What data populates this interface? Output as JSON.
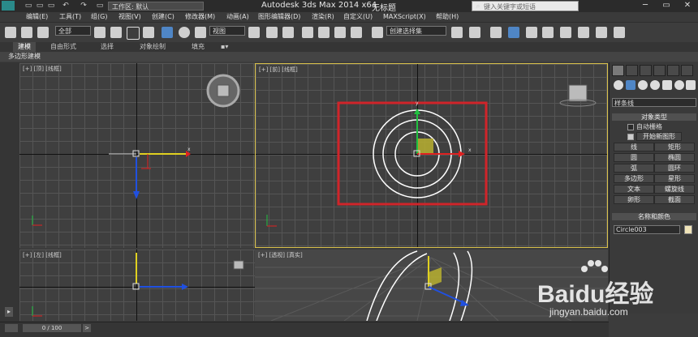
{
  "titlebar": {
    "workspace_label": "工作区: 默认",
    "app_title": "Autodesk 3ds Max  2014 x64",
    "doc_title": "无标题",
    "search_placeholder": "键入关键字或短语"
  },
  "menubar": {
    "items": [
      "编辑(E)",
      "工具(T)",
      "组(G)",
      "视图(V)",
      "创建(C)",
      "修改器(M)",
      "动画(A)",
      "图形编辑器(D)",
      "渲染(R)",
      "自定义(U)",
      "MAXScript(X)",
      "帮助(H)"
    ]
  },
  "toolbar": {
    "filter_select": "全部",
    "refcoord_select": "视图",
    "selection_set": "创建选择集"
  },
  "ribbon": {
    "tabs": [
      "建模",
      "自由形式",
      "选择",
      "对象绘制",
      "填充"
    ],
    "active_tab": "建模",
    "subbar_label": "多边形建模"
  },
  "viewports": {
    "top_left_label": "[+] [顶] [线框]",
    "front_label": "[+] [前] [线框]",
    "left_label": "[+] [左] [线框]",
    "perspective_label": "[+] [透视] [真实]"
  },
  "command_panel": {
    "shape_type": "样条线",
    "object_type_header": "对象类型",
    "auto_grid": "自动栅格",
    "start_new_shape": "开始新图形",
    "buttons": [
      "线",
      "矩形",
      "圆",
      "椭圆",
      "弧",
      "圆环",
      "多边形",
      "星形",
      "文本",
      "螺旋线",
      "卵形",
      "截面"
    ],
    "name_color_header": "名称和颜色",
    "object_name": "Circle003",
    "object_color": "#f0e4b8"
  },
  "timeline": {
    "frame_display": "0 / 100"
  },
  "watermark": {
    "logo_text": "Baidu经验",
    "url": "jingyan.baidu.com"
  },
  "colors": {
    "selection_highlight": "#d0242a",
    "active_viewport_border": "#d8c04a",
    "x_axis": "#e02020",
    "y_axis": "#20c040",
    "z_axis": "#2050e0",
    "gizmo_yellow": "#e0d020"
  }
}
